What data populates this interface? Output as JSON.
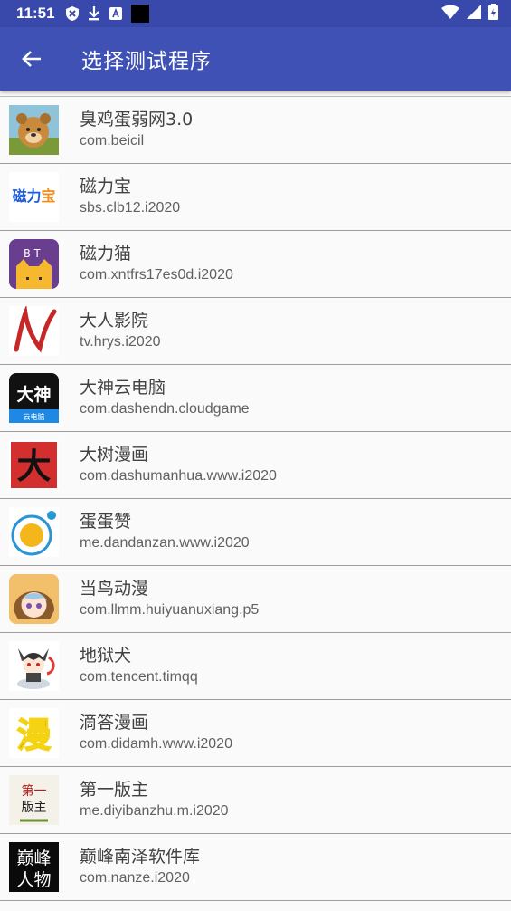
{
  "status": {
    "time": "11:51"
  },
  "appbar": {
    "title": "选择测试程序"
  },
  "apps": [
    {
      "name": "臭鸡蛋弱网3.0",
      "package": "com.beicil",
      "icon": "bear-icon"
    },
    {
      "name": "磁力宝",
      "package": "sbs.clb12.i2020",
      "icon": "cilibao-text-icon",
      "icon_text": "磁力宝"
    },
    {
      "name": "磁力猫",
      "package": "com.xntfrs17es0d.i2020",
      "icon": "bt-cat-icon",
      "icon_text": "BT"
    },
    {
      "name": "大人影院",
      "package": "tv.hrys.i2020",
      "icon": "red-n-logo-icon"
    },
    {
      "name": "大神云电脑",
      "package": "com.dashendn.cloudgame",
      "icon": "dashen-icon",
      "icon_text": "大神",
      "icon_subtext": "云电脑"
    },
    {
      "name": "大树漫画",
      "package": "com.dashumanhua.www.i2020",
      "icon": "dashu-icon",
      "icon_text": "大"
    },
    {
      "name": "蛋蛋赞",
      "package": "me.dandanzan.www.i2020",
      "icon": "egg-circle-icon"
    },
    {
      "name": "当鸟动漫",
      "package": "com.llmm.huiyuanuxiang.p5",
      "icon": "anime-girl-icon"
    },
    {
      "name": "地狱犬",
      "package": "com.tencent.timqq",
      "icon": "chibi-character-icon"
    },
    {
      "name": "滴答漫画",
      "package": "com.didamh.www.i2020",
      "icon": "man-text-icon",
      "icon_text": "漫"
    },
    {
      "name": "第一版主",
      "package": "me.diyibanzhu.m.i2020",
      "icon": "diyibanzhu-icon",
      "icon_text": "第一",
      "icon_subtext": "版主"
    },
    {
      "name": "巅峰南泽软件库",
      "package": "com.nanze.i2020",
      "icon": "calligraphy-icon",
      "icon_text": "巅峰",
      "icon_subtext": "人物"
    }
  ]
}
